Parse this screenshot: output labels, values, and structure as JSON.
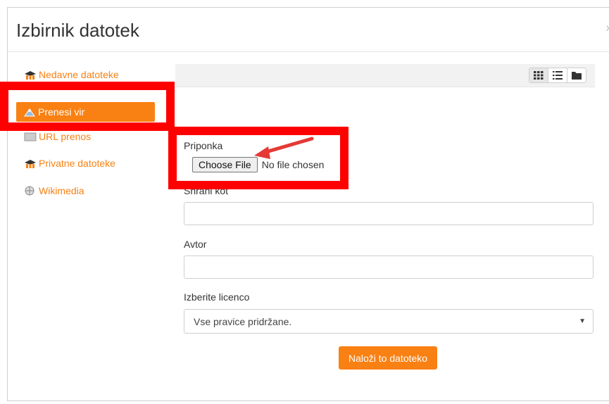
{
  "dialog": {
    "title": "Izbirnik datotek",
    "close_glyph": "x"
  },
  "sidebar": {
    "items": [
      {
        "label": "Nedavne datoteke",
        "icon": "moodle-hat-icon"
      },
      {
        "label": "Prenesi vir",
        "icon": "upload-icon",
        "active": true
      },
      {
        "label": "URL prenos",
        "icon": "url-icon"
      },
      {
        "label": "Privatne datoteke",
        "icon": "moodle-hat-icon"
      },
      {
        "label": "Wikimedia",
        "icon": "wikimedia-icon"
      }
    ]
  },
  "toolbar": {
    "views": [
      "grid-view-icon",
      "list-view-icon",
      "folder-view-icon"
    ]
  },
  "form": {
    "attachment_label": "Priponka",
    "choose_file_label": "Choose File",
    "no_file_text": "No file chosen",
    "save_as_label": "Shrani kot",
    "author_label": "Avtor",
    "license_label": "Izberite licenco",
    "license_value": "Vse pravice pridržane.",
    "submit_label": "Naloži to datoteko"
  },
  "colors": {
    "accent": "#f98012",
    "highlight": "#ff0000",
    "arrow": "#e53935"
  }
}
